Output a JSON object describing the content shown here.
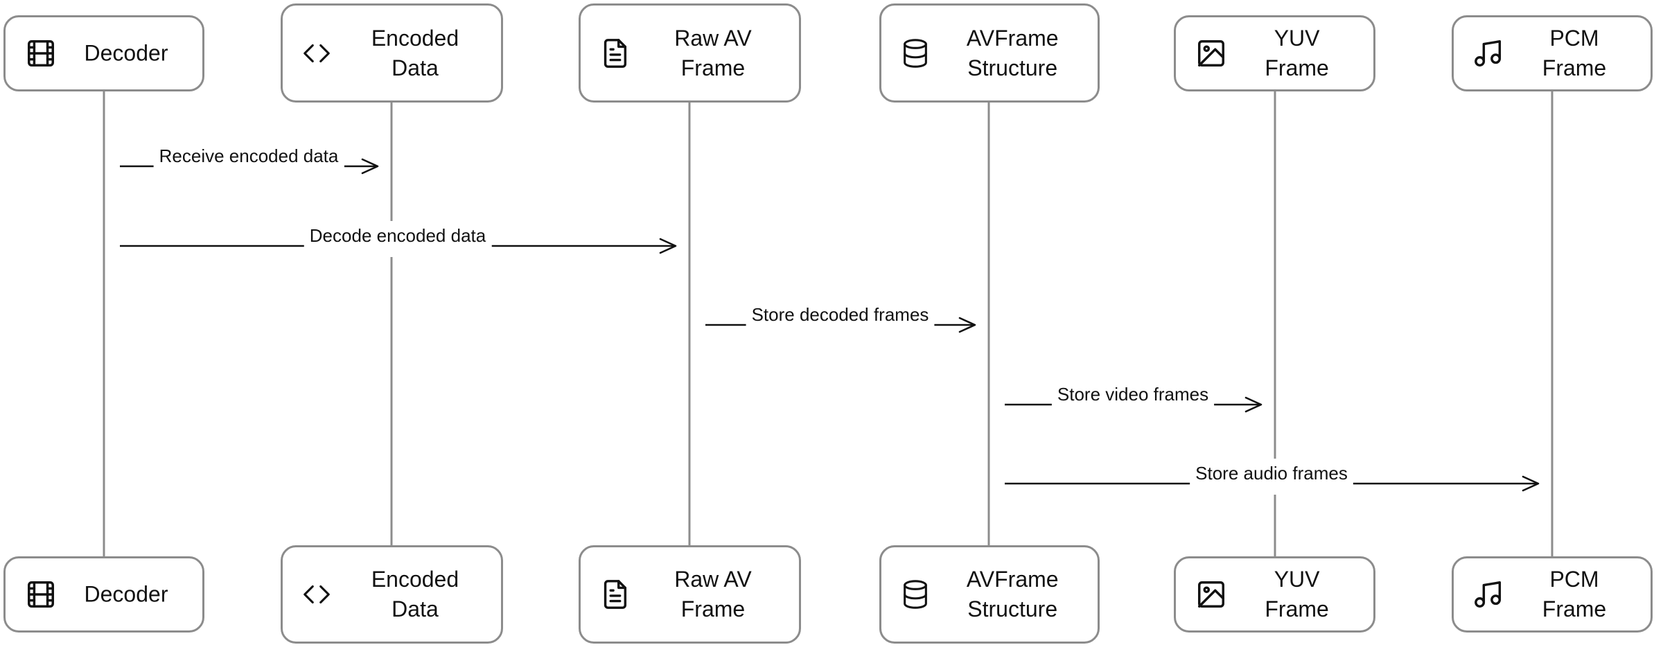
{
  "diagram": {
    "type": "sequence",
    "participants": [
      {
        "id": "decoder",
        "label": "Decoder",
        "icon": "film-icon"
      },
      {
        "id": "encoded-data",
        "label": "Encoded\nData",
        "icon": "code-icon"
      },
      {
        "id": "raw-av-frame",
        "label": "Raw AV\nFrame",
        "icon": "file-text-icon"
      },
      {
        "id": "avframe-structure",
        "label": "AVFrame\nStructure",
        "icon": "database-icon"
      },
      {
        "id": "yuv-frame",
        "label": "YUV Frame",
        "icon": "image-icon"
      },
      {
        "id": "pcm-frame",
        "label": "PCM Frame",
        "icon": "music-icon"
      }
    ],
    "messages": [
      {
        "from": "decoder",
        "to": "encoded-data",
        "label": "Receive encoded data"
      },
      {
        "from": "decoder",
        "to": "raw-av-frame",
        "label": "Decode encoded data"
      },
      {
        "from": "raw-av-frame",
        "to": "avframe-structure",
        "label": "Store decoded frames"
      },
      {
        "from": "avframe-structure",
        "to": "yuv-frame",
        "label": "Store video frames"
      },
      {
        "from": "avframe-structure",
        "to": "pcm-frame",
        "label": "Store audio frames"
      }
    ]
  }
}
